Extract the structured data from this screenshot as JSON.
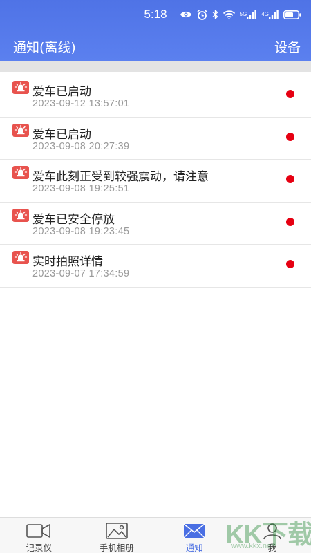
{
  "status_bar": {
    "time": "5:18",
    "icons": [
      "eye-icon",
      "alarm-icon",
      "bluetooth-icon",
      "wifi-icon",
      "signal-5g-icon",
      "signal-4g-icon",
      "battery-icon"
    ],
    "network_5g": "5G",
    "network_4g": "4G"
  },
  "header": {
    "title": "通知(离线)",
    "right_action": "设备"
  },
  "notifications": [
    {
      "title": "爱车已启动",
      "time": "2023-09-12 13:57:01",
      "unread": true
    },
    {
      "title": "爱车已启动",
      "time": "2023-09-08 20:27:39",
      "unread": true
    },
    {
      "title": "爱车此刻正受到较强震动，请注意",
      "time": "2023-09-08 19:25:51",
      "unread": true
    },
    {
      "title": "爱车已安全停放",
      "time": "2023-09-08 19:23:45",
      "unread": true
    },
    {
      "title": "实时拍照详情",
      "time": "2023-09-07 17:34:59",
      "unread": true
    }
  ],
  "bottom_nav": [
    {
      "label": "记录仪",
      "icon": "video-camera-icon",
      "active": false
    },
    {
      "label": "手机相册",
      "icon": "image-icon",
      "active": false
    },
    {
      "label": "通知",
      "icon": "envelope-icon",
      "active": true
    },
    {
      "label": "我",
      "icon": "person-icon",
      "active": false
    }
  ],
  "watermark": {
    "text": "KK下载",
    "sub": "www.kkx.net"
  },
  "colors": {
    "header": "#5079e8",
    "active_tab": "#4a6fe3",
    "unread_dot": "#e60012",
    "notification_icon": "#e8534e",
    "timestamp": "#9a9a9a"
  }
}
